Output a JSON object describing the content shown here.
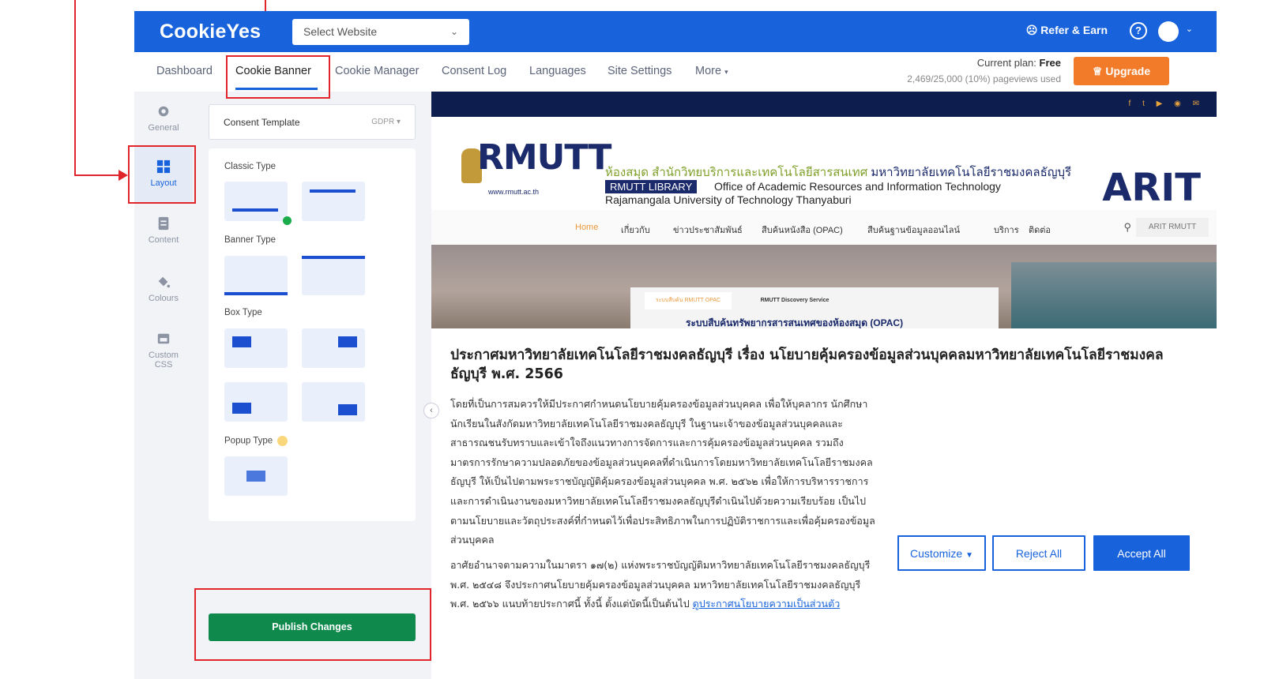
{
  "topbar": {
    "logo": "CookieYes",
    "site_select": "Select Website",
    "refer": "Refer & Earn",
    "help": "?"
  },
  "nav": {
    "tabs": [
      "Dashboard",
      "Cookie Banner",
      "Cookie Manager",
      "Consent Log",
      "Languages",
      "Site Settings",
      "More"
    ],
    "active_tab": "Cookie Banner",
    "plan_label": "Current plan:",
    "plan_value": "Free",
    "pageviews": "2,469/25,000 (10%) pageviews used",
    "upgrade": "Upgrade"
  },
  "iconbar": {
    "items": [
      {
        "label": "General",
        "icon": "gear-icon"
      },
      {
        "label": "Layout",
        "icon": "grid-icon"
      },
      {
        "label": "Content",
        "icon": "document-icon"
      },
      {
        "label": "Colours",
        "icon": "paint-bucket-icon"
      },
      {
        "label": "Custom CSS",
        "icon": "css-icon"
      }
    ],
    "active": "Layout"
  },
  "panel": {
    "template_label": "Consent Template",
    "template_value": "GDPR",
    "classic": "Classic Type",
    "banner": "Banner Type",
    "box": "Box Type",
    "popup": "Popup Type",
    "publish": "Publish Changes"
  },
  "preview": {
    "site_logo": "RMUTT",
    "site_url": "www.rmutt.ac.th",
    "thai_library": "ห้องสมุด สำนักวิทยบริการและเทคโนโลยีสารสนเทศ",
    "thai_university": "มหาวิทยาลัยเทคโนโลยีราชมงคลธัญบุรี",
    "library_badge": "RMUTT LIBRARY",
    "office": "Office of Academic Resources and Information Technology",
    "university": "Rajamangala University of Technology Thanyaburi",
    "arit_logo": "ARIT",
    "menu": [
      "Home",
      "เกี่ยวกับ",
      "ข่าวประชาสัมพันธ์",
      "สืบค้นหนังสือ (OPAC)",
      "สืบค้นฐานข้อมูลออนไลน์",
      "บริการ",
      "ติดต่อ"
    ],
    "menu_right": "ARIT RMUTT",
    "hero_tab1": "ระบบสืบค้น RMUTT OPAC",
    "hero_tab2": "RMUTT Discovery Service",
    "hero_text": "ระบบสืบค้นทรัพยากรสารสนเทศของห้องสมุด (OPAC)"
  },
  "banner": {
    "title": "ประกาศมหาวิทยาลัยเทคโนโลยีราชมงคลธัญบุรี เรื่อง นโยบายคุ้มครองข้อมูลส่วนบุคคลมหาวิทยาลัยเทคโนโลยีราชมงคลธัญบุรี พ.ศ. 2566",
    "para1": "โดยที่เป็นการสมควรให้มีประกาศกำหนดนโยบายคุ้มครองข้อมูลส่วนบุคคล เพื่อให้บุคลากร นักศึกษา นักเรียนในสังกัดมหาวิทยาลัยเทคโนโลยีราชมงคลธัญบุรี ในฐานะเจ้าของข้อมูลส่วนบุคคลและสาธารณชนรับทราบและเข้าใจถึงแนวทางการจัดการและการคุ้มครองข้อมูลส่วนบุคคล รวมถึงมาตรการรักษาความปลอดภัยของข้อมูลส่วนบุคคลที่ดำเนินการโดยมหาวิทยาลัยเทคโนโลยีราชมงคลธัญบุรี ให้เป็นไปตามพระราชบัญญัติคุ้มครองข้อมูลส่วนบุคคล พ.ศ. ๒๕๖๒ เพื่อให้การบริหารราชการและการดำเนินงานของมหาวิทยาลัยเทคโนโลยีราชมงคลธัญบุรีดำเนินไปด้วยความเรียบร้อย เป็นไปตามนโยบายและวัตถุประสงค์ที่กำหนดไว้เพื่อประสิทธิภาพในการปฏิบัติราชการและเพื่อคุ้มครองข้อมูลส่วนบุคคล",
    "para2": "อาศัยอำนาจตามความในมาตรา ๑๗(๒) แห่งพระราชบัญญัติมหาวิทยาลัยเทคโนโลยีราชมงคลธัญบุรี พ.ศ. ๒๕๔๘ จึงประกาศนโยบายคุ้มครองข้อมูลส่วนบุคคล มหาวิทยาลัยเทคโนโลยีราชมงคลธัญบุรี พ.ศ. ๒๕๖๖ แนบท้ายประกาศนี้ ทั้งนี้ ตั้งแต่บัดนี้เป็นต้นไป",
    "link": "ดูประกาศนโยบายความเป็นส่วนตัว",
    "customize": "Customize",
    "reject": "Reject All",
    "accept": "Accept All"
  },
  "colors": {
    "brand_blue": "#1863dc",
    "publish_green": "#0f8a4c",
    "upgrade_orange": "#f27b2a",
    "annotation_red": "#e0262b"
  }
}
